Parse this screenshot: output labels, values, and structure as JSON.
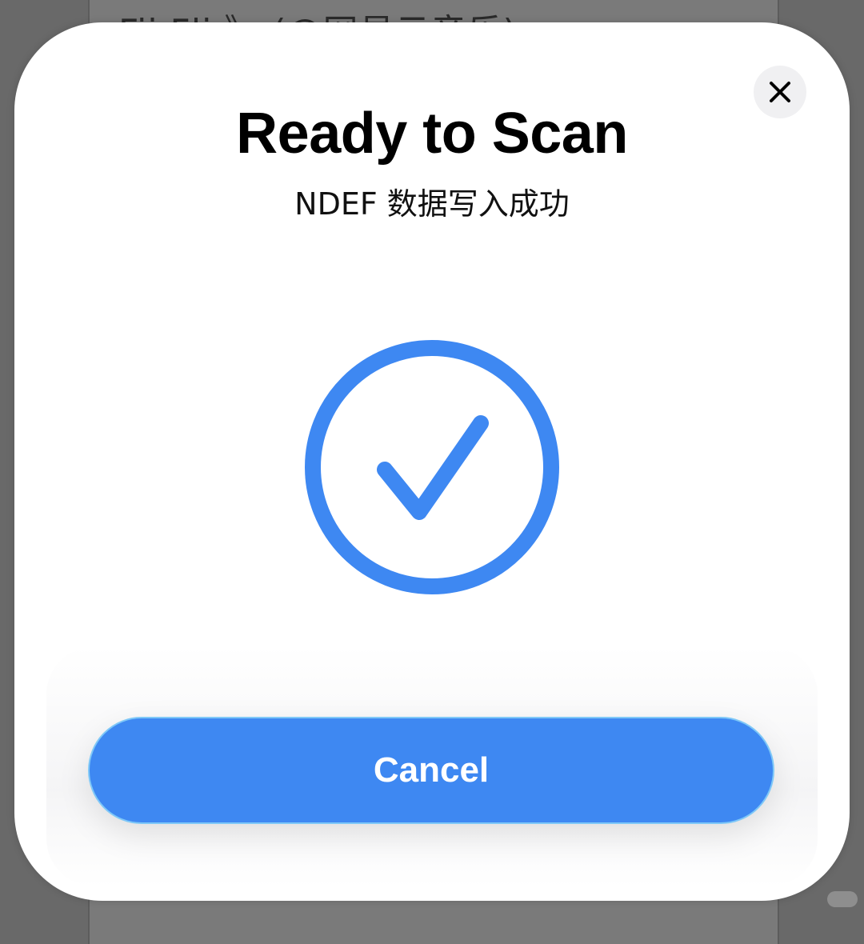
{
  "background": {
    "partial_text": "Fii Fli  》 (@网易云音乐)"
  },
  "sheet": {
    "title": "Ready to Scan",
    "subtitle": "NDEF 数据写入成功",
    "status_icon": "checkmark-circle-icon",
    "close_icon": "close-icon",
    "cancel_label": "Cancel"
  },
  "colors": {
    "accent": "#3e88f2",
    "sheet_background": "#ffffff",
    "dim_background": "#696969"
  }
}
